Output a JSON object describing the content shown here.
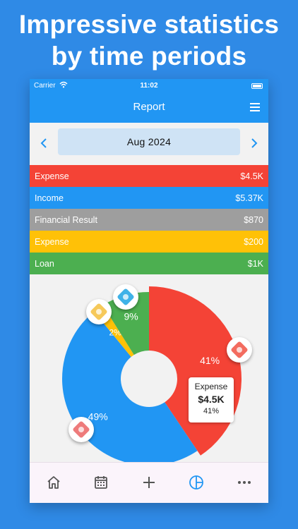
{
  "headline": {
    "line1": "Impressive statistics",
    "line2": "by time periods"
  },
  "status": {
    "carrier": "Carrier",
    "time": "11:02"
  },
  "navbar": {
    "title": "Report",
    "menu_icon": "hamburger-icon"
  },
  "period": {
    "label": "Aug 2024",
    "prev_icon": "chevron-left-icon",
    "next_icon": "chevron-right-icon"
  },
  "summary_rows": [
    {
      "label": "Expense",
      "value": "$4.5K",
      "color": "#f44336"
    },
    {
      "label": "Income",
      "value": "$5.37K",
      "color": "#2196f3"
    },
    {
      "label": "Financial Result",
      "value": "$870",
      "color": "#9e9e9e"
    },
    {
      "label": "Expense",
      "value": "$200",
      "color": "#ffc107"
    },
    {
      "label": "Loan",
      "value": "$1K",
      "color": "#4caf50"
    }
  ],
  "chart_data": {
    "type": "pie",
    "slices": [
      {
        "label": "41%",
        "value": 41,
        "color": "#f44336",
        "icon": "shopping-cart-icon"
      },
      {
        "label": "49%",
        "value": 49,
        "color": "#2196f3",
        "icon": "category-icon"
      },
      {
        "label": "2%",
        "value": 2,
        "color": "#ffc107",
        "icon": "category-icon"
      },
      {
        "label": "9%",
        "value": 9,
        "color": "#4caf50",
        "icon": "category-icon"
      }
    ],
    "tooltip": {
      "label": "Expense",
      "value": "$4.5K",
      "percent": "41%"
    }
  },
  "tabbar": {
    "items": [
      {
        "name": "home",
        "icon": "home-icon"
      },
      {
        "name": "calendar",
        "icon": "calendar-icon"
      },
      {
        "name": "add",
        "icon": "plus-icon"
      },
      {
        "name": "report",
        "icon": "pie-chart-icon",
        "active": true
      },
      {
        "name": "more",
        "icon": "more-icon"
      }
    ],
    "active_color": "#2196f3",
    "inactive_color": "#555555"
  }
}
